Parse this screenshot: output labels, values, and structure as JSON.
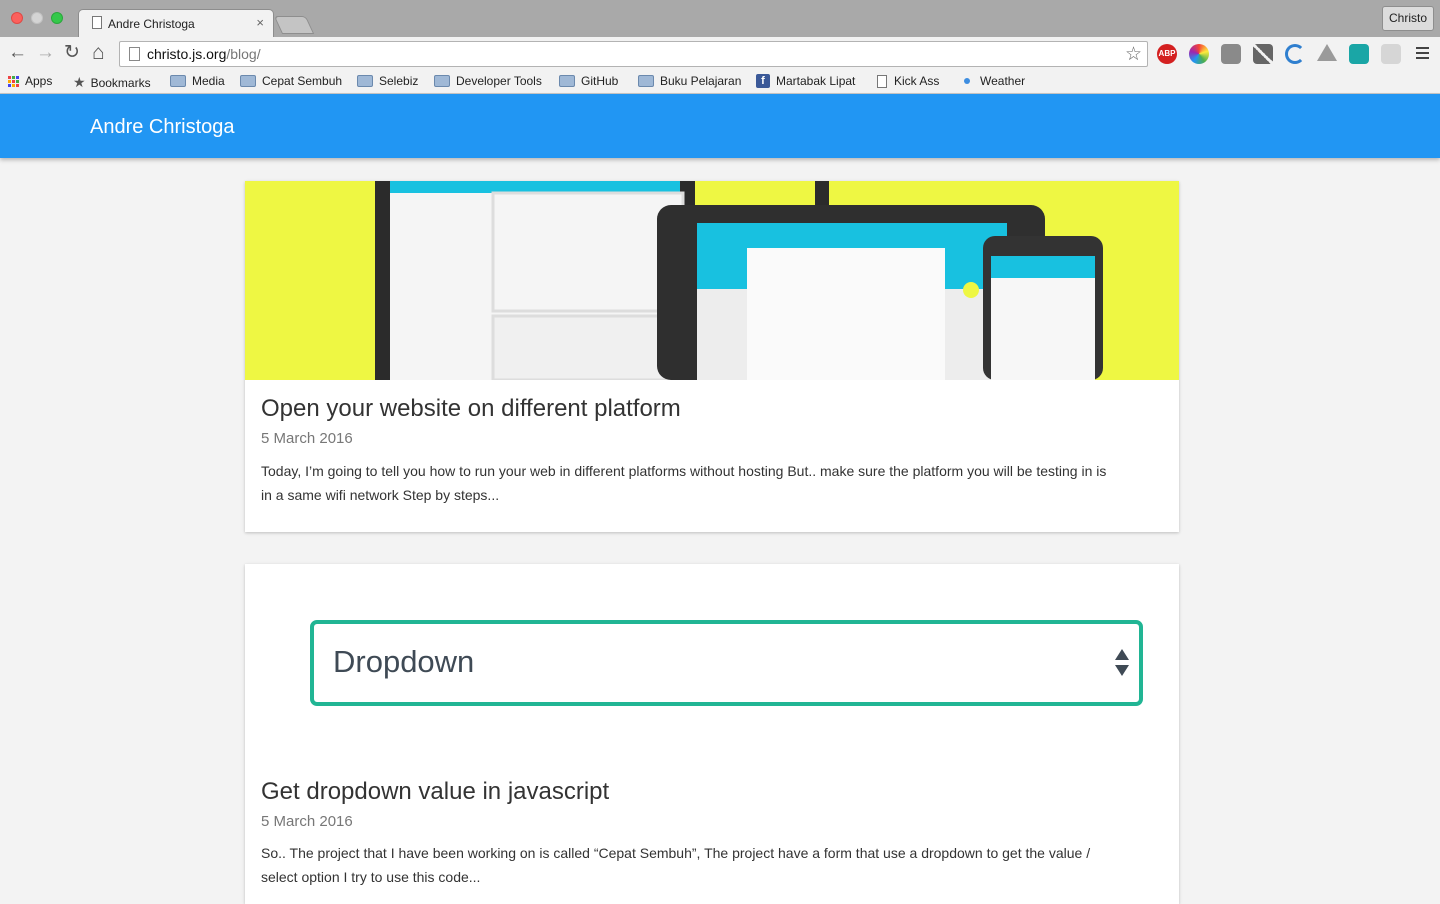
{
  "browser": {
    "tab_title": "Andre Christoga",
    "tab_close": "×",
    "profile_name": "Christo",
    "url_host": "christo.js.org",
    "url_path": "/blog/",
    "nav": {
      "back": "←",
      "forward": "→",
      "reload": "↻",
      "home": "⌂",
      "star": "☆"
    },
    "extensions": [
      "adblock-plus-icon",
      "color-picker-icon",
      "image-icon",
      "magic-wand-icon",
      "wave-icon",
      "google-drive-icon",
      "cloud-app-icon",
      "shield-icon"
    ],
    "abp_label": "ABP"
  },
  "bookmarks": [
    {
      "label": "Apps",
      "icon": "apps-grid-icon"
    },
    {
      "label": "Bookmarks",
      "icon": "star-icon"
    },
    {
      "label": "Media",
      "icon": "folder-icon"
    },
    {
      "label": "Cepat Sembuh",
      "icon": "folder-icon"
    },
    {
      "label": "Selebiz",
      "icon": "folder-icon"
    },
    {
      "label": "Developer Tools",
      "icon": "folder-icon"
    },
    {
      "label": "GitHub",
      "icon": "folder-icon"
    },
    {
      "label": "Buku Pelajaran",
      "icon": "folder-icon"
    },
    {
      "label": "Martabak Lipat",
      "icon": "facebook-icon"
    },
    {
      "label": "Kick Ass",
      "icon": "page-icon"
    },
    {
      "label": "Weather",
      "icon": "dot-icon"
    }
  ],
  "site": {
    "brand": "Andre Christoga",
    "brand_color": "#2196f3"
  },
  "posts": [
    {
      "title": "Open your website on different platform",
      "date": "5 March 2016",
      "excerpt": "Today, I’m going to tell you how to run your web in different platforms without hosting But.. make sure the platform you will be testing in is in a same wifi network Step by steps...",
      "image": "devices-illustration"
    },
    {
      "title": "Get dropdown value in javascript",
      "date": "5 March 2016",
      "excerpt": "So.. The project that I have been working on is called “Cepat Sembuh”, The project have a form that use a dropdown to get the value / select option I try to use this code...",
      "image_label": "Dropdown",
      "image_accent": "#21b594"
    }
  ]
}
